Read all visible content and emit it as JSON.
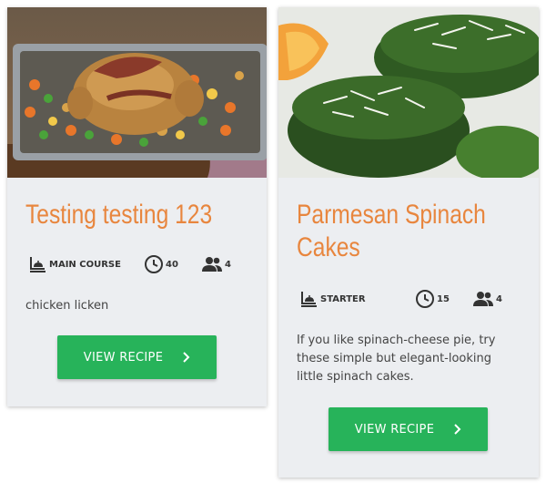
{
  "cards": [
    {
      "title": "Testing testing 123",
      "course": "MAIN COURSE",
      "time": "40",
      "servings": "4",
      "description": "chicken licken",
      "button_label": "VIEW RECIPE"
    },
    {
      "title_line1": "Parmesan Spinach",
      "title_line2": "Cakes",
      "course": "STARTER",
      "time": "15",
      "servings": "4",
      "description": "If you like spinach-cheese pie, try these simple but elegant-looking little spinach cakes.",
      "button_label": "VIEW RECIPE"
    }
  ],
  "colors": {
    "title": "#e8863e",
    "button": "#27b35a",
    "card_background": "#eceef1"
  },
  "icons": {
    "course": "course-icon",
    "time": "clock-icon",
    "servings": "people-icon",
    "button": "chevron-right-icon"
  }
}
